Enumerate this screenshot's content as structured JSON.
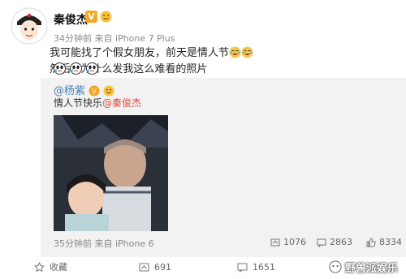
{
  "post": {
    "author": "秦俊杰",
    "verified_badge": "V",
    "time": "34分钟前",
    "source": "来自 iPhone 7 Plus",
    "text_before": "我可能找了个假女朋友，前天是情人节",
    "text_mid": "然后...为什么发我这么难看的照片"
  },
  "repost": {
    "author": "@杨紫",
    "text": "情人节快乐",
    "mention": "@秦俊杰",
    "time": "35分钟前",
    "source": "来自 iPhone 6",
    "repost_count": "1076",
    "comment_count": "2863",
    "like_count": "8334"
  },
  "actions": {
    "favorite": "收藏",
    "repost_count": "691",
    "comment_count": "1651"
  },
  "watermark": "野兽派娱乐",
  "colors": {
    "link": "#4a7eb5",
    "mention": "#e24b3b",
    "repost_bg": "#f2f2f2",
    "badge": "#f5a623"
  }
}
